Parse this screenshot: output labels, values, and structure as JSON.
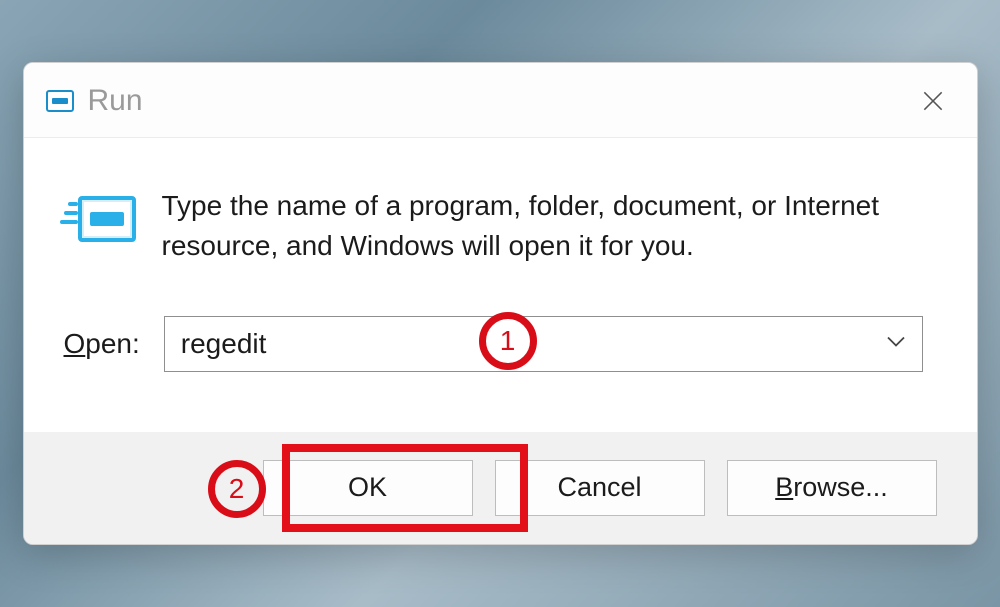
{
  "titlebar": {
    "title": "Run"
  },
  "body": {
    "description": "Type the name of a program, folder, document, or Internet resource, and Windows will open it for you.",
    "open_label_prefix": "O",
    "open_label_rest": "pen:",
    "input_value": "regedit"
  },
  "buttons": {
    "ok": "OK",
    "cancel": "Cancel",
    "browse_prefix": "B",
    "browse_rest": "rowse..."
  },
  "annotations": {
    "step1": "1",
    "step2": "2"
  }
}
